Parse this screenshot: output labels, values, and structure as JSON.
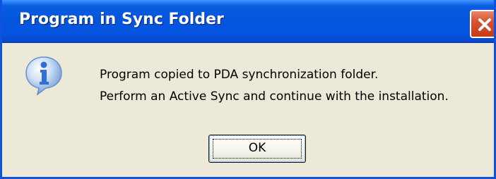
{
  "dialog": {
    "title": "Program in Sync Folder",
    "icon": "info-icon",
    "message_line1": "Program copied to PDA synchronization folder.",
    "message_line2": "Perform an Active Sync and continue with the installation.",
    "ok_label": "OK"
  },
  "colors": {
    "titlebar": "#0355dd",
    "window_background": "#ece9d8",
    "close_button": "#d8522f",
    "info_icon": "#2f6fd6"
  }
}
